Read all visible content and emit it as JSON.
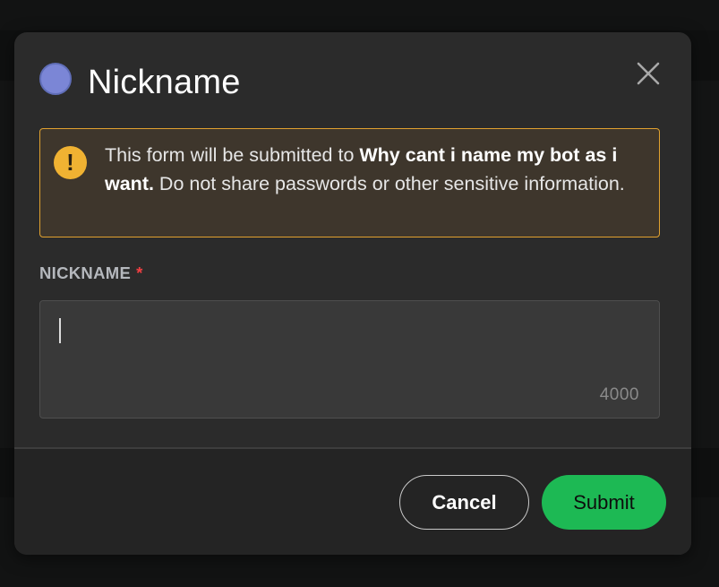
{
  "modal": {
    "title": "Nickname",
    "avatar_color": "#7b86d6",
    "close_icon": "close-icon",
    "warning": {
      "icon": "exclamation-icon",
      "color": "#f0b232",
      "text_before": "This form will be submitted to ",
      "recipient": "Why cant i name my bot as i want.",
      "text_after": " Do not share passwords or other sensitive information."
    },
    "field": {
      "label": "NICKNAME",
      "required_marker": "*",
      "value": "",
      "char_counter": "4000"
    },
    "buttons": {
      "cancel_label": "Cancel",
      "submit_label": "Submit",
      "submit_color": "#1db954"
    }
  }
}
